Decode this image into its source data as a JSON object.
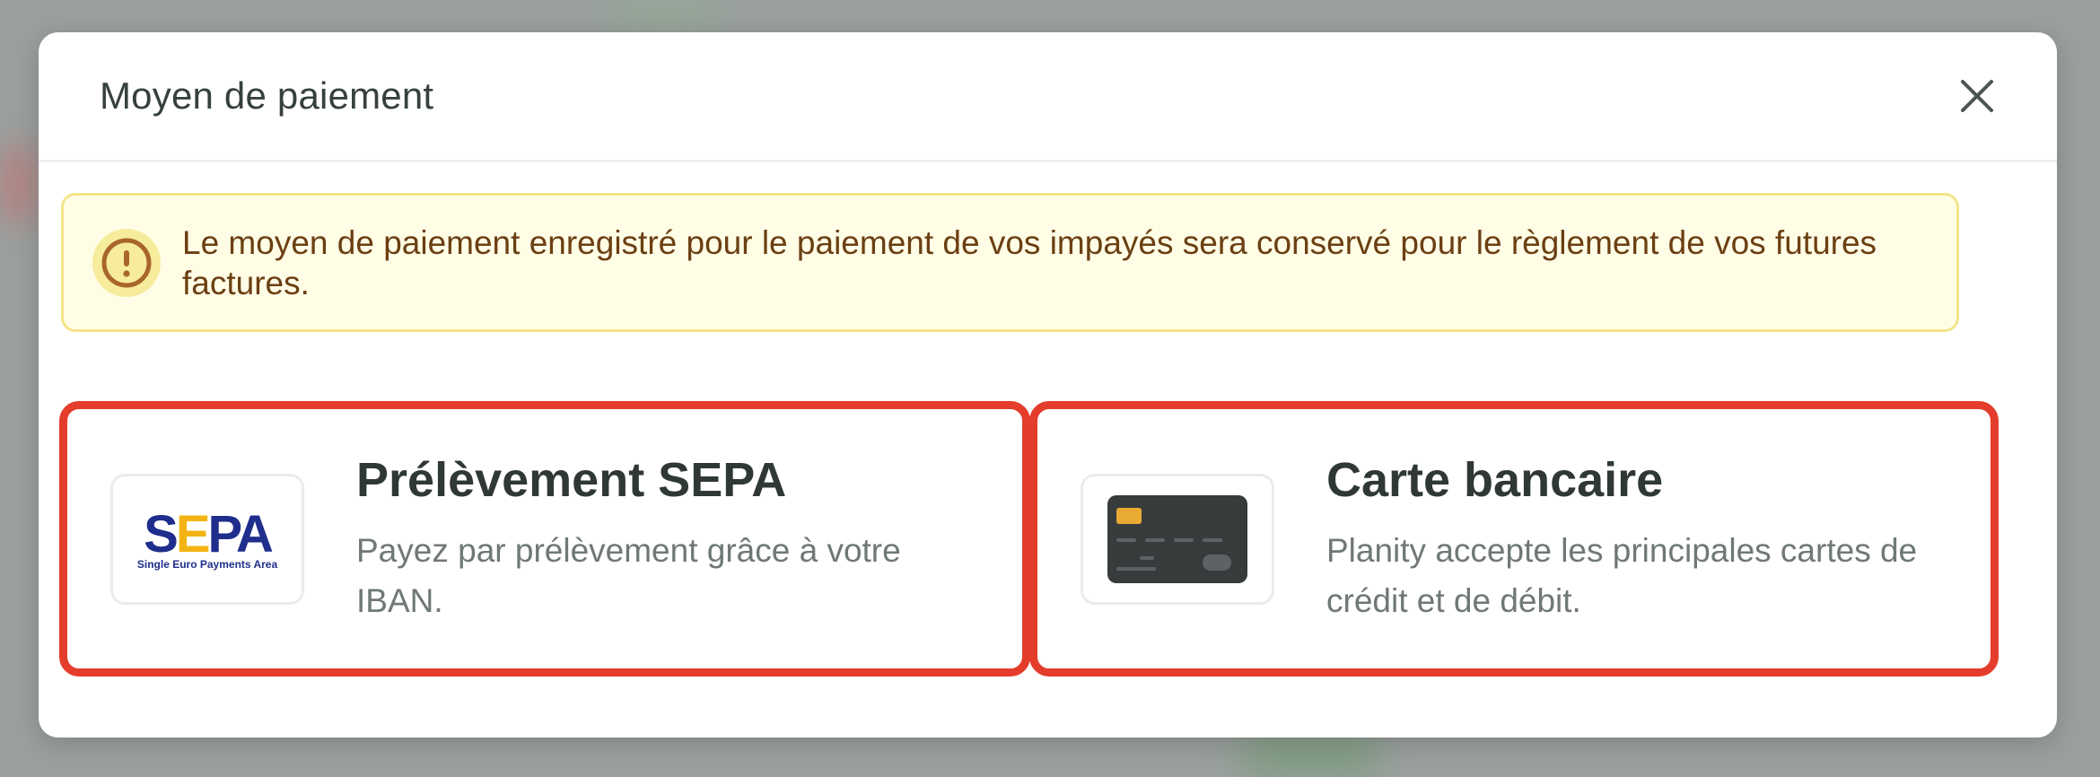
{
  "modal": {
    "title": "Moyen de paiement"
  },
  "alert": {
    "icon": "exclamation-circle-icon",
    "text": "Le moyen de paiement enregistré pour le paiement de vos impayés sera conservé pour le règlement de vos futures factures."
  },
  "options": [
    {
      "title": "Prélèvement SEPA",
      "description": "Payez par prélèvement grâce à votre IBAN.",
      "logo_text": "SEPA",
      "logo_subtext": "Single Euro Payments Area"
    },
    {
      "title": "Carte bancaire",
      "description": "Planity accepte les principales cartes de crédit et de débit.",
      "icon": "credit-card-icon"
    }
  ],
  "colors": {
    "selected_border": "#e43d2b",
    "alert_bg": "#fffde6",
    "alert_border": "#f3e48a",
    "alert_text": "#6b3f12",
    "sepa_blue": "#1f2e8c",
    "sepa_gold": "#f3b413"
  }
}
